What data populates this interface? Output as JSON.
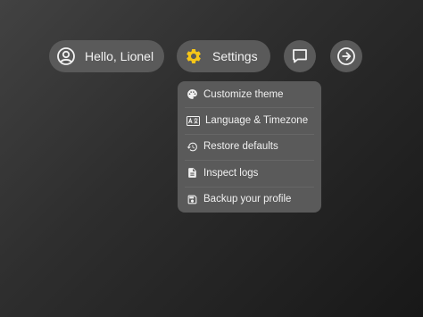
{
  "toolbar": {
    "greeting": "Hello, Lionel",
    "settings_label": "Settings",
    "chat_icon": "chat-bubble-icon",
    "logout_icon": "arrow-right-circle-icon"
  },
  "settings_menu": {
    "items": [
      {
        "label": "Customize theme",
        "icon": "palette-icon"
      },
      {
        "label": "Language & Timezone",
        "icon": "language-icon"
      },
      {
        "label": "Restore defaults",
        "icon": "restore-icon"
      },
      {
        "label": "Inspect logs",
        "icon": "document-icon"
      },
      {
        "label": "Backup your profile",
        "icon": "save-icon"
      }
    ]
  },
  "colors": {
    "pill_background": "#5a5a5a",
    "gear_accent": "#f5c518",
    "text": "#f2f2f2"
  }
}
